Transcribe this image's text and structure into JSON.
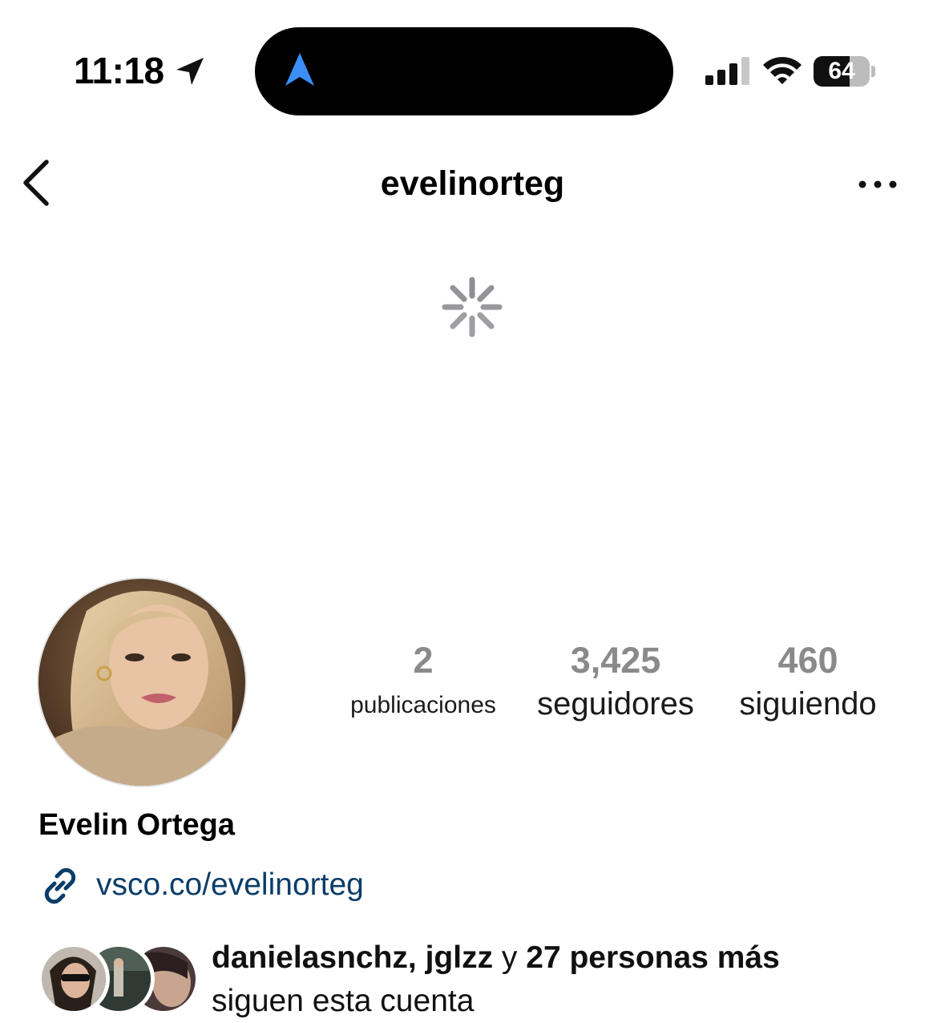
{
  "status_bar": {
    "time": "11:18",
    "battery_level": "64",
    "icons": [
      "location-arrow-icon",
      "navigation-arrow-icon",
      "cellular-signal-icon",
      "wifi-icon",
      "battery-icon"
    ]
  },
  "header": {
    "username": "evelinorteg",
    "back_icon": "chevron-left-icon",
    "more_icon": "more-dots-icon"
  },
  "loading": {
    "icon": "spinner-icon"
  },
  "profile": {
    "display_name": "Evelin Ortega",
    "link": "vsco.co/evelinorteg",
    "link_icon": "link-icon",
    "stats": {
      "posts": {
        "value": "2",
        "label": "publicaciones"
      },
      "followers": {
        "value": "3,425",
        "label": "seguidores"
      },
      "following": {
        "value": "460",
        "label": "siguiendo"
      }
    }
  },
  "followed_by": {
    "user1": "danielasnchz",
    "separator": ", ",
    "user2": "jglzz",
    "conjunction": " y ",
    "others": "27 personas más",
    "suffix": "siguen esta cuenta"
  },
  "colors": {
    "stat_value": "#8a8a8a",
    "link": "#0b3d68",
    "nav_arrow": "#3a8ef6",
    "spinner": "#8e8e93"
  }
}
